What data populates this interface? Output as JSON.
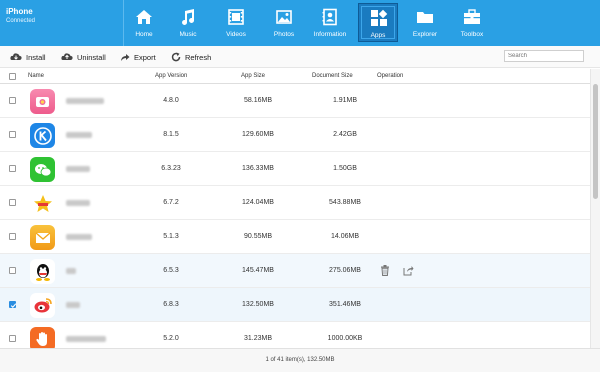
{
  "device": {
    "name": "iPhone",
    "status": "Connected"
  },
  "nav": [
    {
      "label": "Home",
      "icon": "home-icon"
    },
    {
      "label": "Music",
      "icon": "music-icon"
    },
    {
      "label": "Videos",
      "icon": "video-icon"
    },
    {
      "label": "Photos",
      "icon": "photos-icon"
    },
    {
      "label": "Information",
      "icon": "contacts-icon"
    },
    {
      "label": "Apps",
      "icon": "apps-icon",
      "active": true
    },
    {
      "label": "Explorer",
      "icon": "folder-icon"
    },
    {
      "label": "Toolbox",
      "icon": "toolbox-icon"
    }
  ],
  "toolbar": {
    "install": "Install",
    "uninstall": "Uninstall",
    "export": "Export",
    "refresh": "Refresh",
    "search_placeholder": "Search"
  },
  "table": {
    "headers": {
      "name": "Name",
      "version": "App Version",
      "app_size": "App Size",
      "doc_size": "Document Size",
      "operation": "Operation"
    },
    "rows": [
      {
        "version": "4.8.0",
        "app_size": "58.16MB",
        "doc_size": "1.91MB",
        "icon_color": "#f06b9a",
        "icon": "camera-app-icon"
      },
      {
        "version": "8.1.5",
        "app_size": "129.60MB",
        "doc_size": "2.42GB",
        "icon_color": "#1e86e6",
        "icon": "kugou-icon"
      },
      {
        "version": "6.3.23",
        "app_size": "136.33MB",
        "doc_size": "1.50GB",
        "icon_color": "#2fc233",
        "icon": "wechat-icon"
      },
      {
        "version": "6.7.2",
        "app_size": "124.04MB",
        "doc_size": "543.88MB",
        "icon_color": "#f5c01b",
        "icon": "star-app-icon"
      },
      {
        "version": "5.1.3",
        "app_size": "90.55MB",
        "doc_size": "14.06MB",
        "icon_color": "#f3a61a",
        "icon": "mail-app-icon"
      },
      {
        "version": "6.5.3",
        "app_size": "145.47MB",
        "doc_size": "275.06MB",
        "icon_color": "#ffffff",
        "icon": "qq-icon",
        "hover": true
      },
      {
        "version": "6.8.3",
        "app_size": "132.50MB",
        "doc_size": "351.46MB",
        "icon_color": "#e8343a",
        "icon": "weibo-icon",
        "checked": true
      },
      {
        "version": "5.2.0",
        "app_size": "31.23MB",
        "doc_size": "1000.00KB",
        "icon_color": "#f46b24",
        "icon": "hand-app-icon"
      }
    ]
  },
  "footer": {
    "status": "1 of 41 item(s), 132.50MB"
  }
}
